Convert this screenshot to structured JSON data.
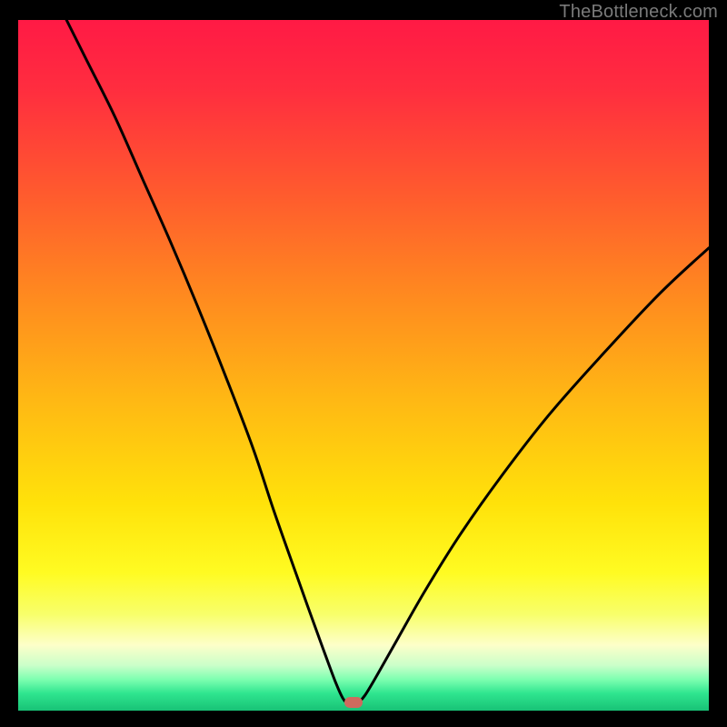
{
  "watermark": "TheBottleneck.com",
  "colors": {
    "black": "#000000",
    "curve": "#000000",
    "marker": "#cf6a5e",
    "gradient_stops": [
      {
        "offset": 0.0,
        "color": "#ff1a45"
      },
      {
        "offset": 0.1,
        "color": "#ff2d3f"
      },
      {
        "offset": 0.25,
        "color": "#ff5a2e"
      },
      {
        "offset": 0.4,
        "color": "#ff8a1f"
      },
      {
        "offset": 0.55,
        "color": "#ffb814"
      },
      {
        "offset": 0.7,
        "color": "#ffe20a"
      },
      {
        "offset": 0.8,
        "color": "#fffb22"
      },
      {
        "offset": 0.86,
        "color": "#f8ff6a"
      },
      {
        "offset": 0.905,
        "color": "#fdffc9"
      },
      {
        "offset": 0.935,
        "color": "#c9ffc9"
      },
      {
        "offset": 0.955,
        "color": "#7dffb0"
      },
      {
        "offset": 0.975,
        "color": "#2fe58f"
      },
      {
        "offset": 1.0,
        "color": "#18c276"
      }
    ]
  },
  "chart_data": {
    "type": "line",
    "title": "",
    "xlabel": "",
    "ylabel": "",
    "xlim": [
      0,
      100
    ],
    "ylim": [
      0,
      100
    ],
    "grid": false,
    "legend": false,
    "marker": {
      "x": 48.5,
      "y": 1.2
    },
    "series": [
      {
        "name": "curve-left",
        "x": [
          7,
          10,
          14,
          18,
          22,
          26,
          30,
          34,
          37,
          40,
          42.5,
          44.5,
          46,
          47,
          47.6
        ],
        "y": [
          100,
          94,
          86,
          77,
          68,
          58.5,
          48.5,
          38,
          29,
          20.5,
          13.5,
          8,
          4,
          1.8,
          1.1
        ]
      },
      {
        "name": "floor",
        "x": [
          47.6,
          49.2
        ],
        "y": [
          1.1,
          1.1
        ]
      },
      {
        "name": "curve-right",
        "x": [
          49.2,
          50.2,
          52,
          55,
          59,
          64,
          70,
          77,
          85,
          93,
          100
        ],
        "y": [
          1.1,
          2.2,
          5.2,
          10.5,
          17.5,
          25.5,
          34,
          43,
          52,
          60.5,
          67
        ]
      }
    ]
  }
}
